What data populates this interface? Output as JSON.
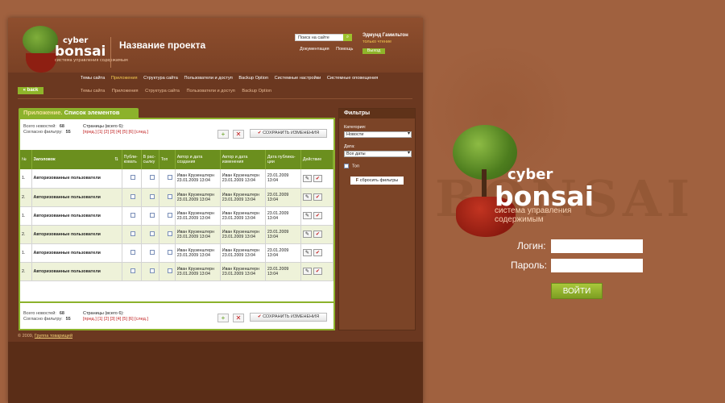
{
  "header": {
    "logo_small": {
      "line1": "cyber",
      "line2": "bonsai",
      "tagline": "система управления содержимым"
    },
    "project_title": "Название проекта",
    "search_placeholder": "Поиск на сайте",
    "links": [
      "Документация",
      "Помощь"
    ],
    "user_name": "Эдмунд Гамильтон",
    "user_role": "только чтение",
    "logout_label": "Выход"
  },
  "nav_main": {
    "items": [
      "Темы сайта",
      "Приложения",
      "Структура сайта",
      "Пользователи и доступ",
      "Backup Option",
      "Системные настройки",
      "Системные оповещения"
    ],
    "active": "Приложения"
  },
  "nav_sub": {
    "back_label": "back",
    "items": [
      "Темы сайта",
      "Приложения",
      "Структура сайта",
      "Пользователи и доступ",
      "Backup Option"
    ]
  },
  "panel": {
    "title_app": "Приложение.",
    "title_list": "Список элементов",
    "stats": {
      "total_label": "Всего новостей:",
      "total_value": "68",
      "filter_label": "Согласно фильтру:",
      "filter_value": "55"
    },
    "pages_label": "Страницы (всего 6):",
    "pages_top": "[пред.] [1] [2] [3] [4] [5] [6] [след.]",
    "pages_bottom": "[пред.] [1] [2] [3] [4] [5] [6] [след.]",
    "save_label": "СОХРАНИТЬ ИЗМЕНЕНИЯ",
    "columns": [
      "№",
      "Заголовок",
      "Публи-ковать",
      "В рас-сылку",
      "Топ",
      "Автор и дата создания",
      "Автор и дата изменения",
      "Дата публика-ции",
      "Действие"
    ],
    "rows": [
      {
        "n": "1.",
        "title": "Авторизованные пользователи",
        "author_c": "Иван Крузенштерн 23.01.2009 13:04",
        "author_m": "Иван Крузенштерн 23.01.2009 13:04",
        "pub": "23.01.2009 13:04"
      },
      {
        "n": "2.",
        "title": "Авторизованные пользователи",
        "author_c": "Иван Крузенштерн 23.01.2009 13:04",
        "author_m": "Иван Крузенштерн 23.01.2009 13:04",
        "pub": "23.01.2009 13:04"
      },
      {
        "n": "1.",
        "title": "Авторизованные пользователи",
        "author_c": "Иван Крузенштерн 23.01.2009 13:04",
        "author_m": "Иван Крузенштерн 23.01.2009 13:04",
        "pub": "23.01.2009 13:04"
      },
      {
        "n": "2.",
        "title": "Авторизованные пользователи",
        "author_c": "Иван Крузенштерн 23.01.2009 13:04",
        "author_m": "Иван Крузенштерн 23.01.2009 13:04",
        "pub": "23.01.2009 13:04"
      },
      {
        "n": "1.",
        "title": "Авторизованные пользователи",
        "author_c": "Иван Крузенштерн 23.01.2009 13:04",
        "author_m": "Иван Крузенштерн 23.01.2009 13:04",
        "pub": "23.01.2009 13:04"
      },
      {
        "n": "2.",
        "title": "Авторизованные пользователи",
        "author_c": "Иван Крузенштерн 23.01.2009 13:04",
        "author_m": "Иван Крузенштерн 23.01.2009 13:04",
        "pub": "23.01.2009 13:04"
      }
    ]
  },
  "filters": {
    "title": "Фильтры",
    "category_label": "Категория:",
    "category_value": "Новости",
    "date_label": "Дата:",
    "date_value": "Все даты",
    "top_label": "Топ",
    "reset_label": "сбросить фильтры"
  },
  "footer": {
    "copyright": "© 2009,",
    "link": "Группа товарищей"
  },
  "login": {
    "brand_line1": "cyber",
    "brand_line2": "bonsai",
    "brand_tagline": "система управления содержимым",
    "login_label": "Логин:",
    "password_label": "Пароль:",
    "submit_label": "ВОЙТИ"
  },
  "bg_text": "BONSAI",
  "colors": {
    "background": "#a0613f",
    "accent_green": "#8cb22c",
    "window": "#6b3820",
    "pot_red": "#8b1a0f"
  }
}
